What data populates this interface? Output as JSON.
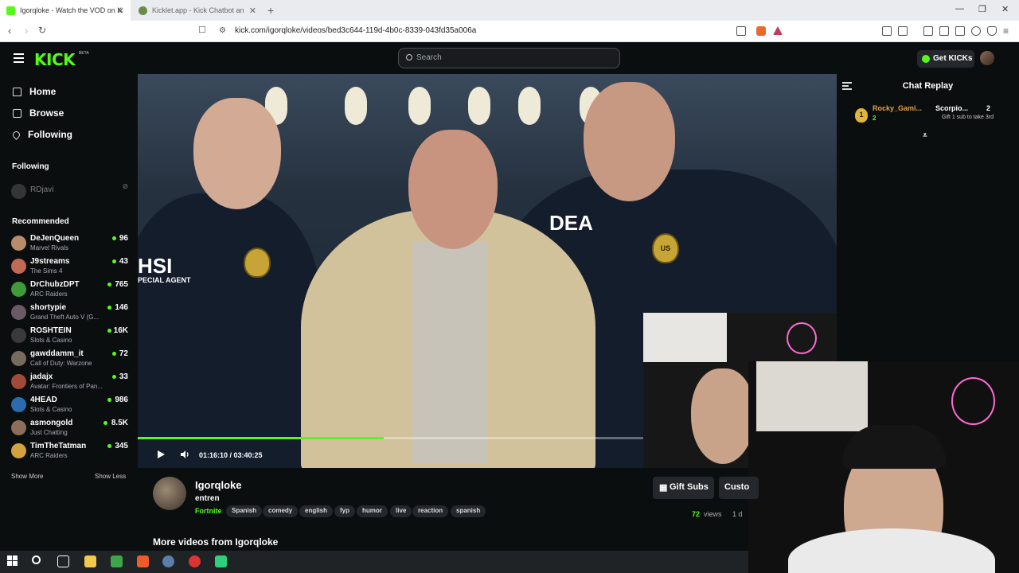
{
  "browser": {
    "tabs": [
      {
        "title": "Igorqloke - Watch the VOD on K",
        "active": true
      },
      {
        "title": "Kicklet.app - Kick Chatbot and C",
        "active": false
      }
    ],
    "url": "kick.com/igorqloke/videos/bed3c644-119d-4b0c-8339-043fd35a006a"
  },
  "header": {
    "logo": "KICK",
    "beta": "BETA",
    "search_placeholder": "Search",
    "get_kicks": "Get KICKs"
  },
  "sidebar": {
    "nav": [
      {
        "label": "Home",
        "icon": "home-icon"
      },
      {
        "label": "Browse",
        "icon": "browse-icon"
      },
      {
        "label": "Following",
        "icon": "heart-icon"
      }
    ],
    "following_heading": "Following",
    "following": [
      {
        "name": "RDjavi"
      }
    ],
    "recommended_heading": "Recommended",
    "recommended": [
      {
        "name": "DeJenQueen",
        "game": "Marvel Rivals",
        "viewers": "96"
      },
      {
        "name": "J9streams",
        "game": "The Sims 4",
        "viewers": "43"
      },
      {
        "name": "DrChubzDPT",
        "game": "ARC Raiders",
        "viewers": "765"
      },
      {
        "name": "shortypie",
        "game": "Grand Theft Auto V (G...",
        "viewers": "146"
      },
      {
        "name": "ROSHTEIN",
        "game": "Slots & Casino",
        "viewers": "16K"
      },
      {
        "name": "gawddamm_it",
        "game": "Call of Duty: Warzone",
        "viewers": "72"
      },
      {
        "name": "jadajx",
        "game": "Avatar: Frontiers of Pan...",
        "viewers": "33"
      },
      {
        "name": "4HEAD",
        "game": "Slots & Casino",
        "viewers": "986"
      },
      {
        "name": "asmongold",
        "game": "Just Chatting",
        "viewers": "8.5K"
      },
      {
        "name": "TimTheTatman",
        "game": "ARC Raiders",
        "viewers": "345"
      }
    ],
    "show_more": "Show More",
    "show_less": "Show Less"
  },
  "player": {
    "time": "01:16:10 / 03:40:25",
    "progress": 0.352,
    "labels": {
      "hsi": "HSI",
      "special_agent": "PECIAL AGENT",
      "dea": "DEA",
      "us": "US"
    }
  },
  "chat": {
    "title": "Chat Replay",
    "gifters": [
      {
        "rank": "1",
        "name": "Rocky_Gami...",
        "count": "2"
      },
      {
        "name": "Scorpio...",
        "count": "2",
        "note": "Gift 1 sub to take 3rd"
      }
    ]
  },
  "channel": {
    "name": "Igorqloke",
    "title": "entren",
    "category": "Fortnite",
    "tags": [
      "Spanish",
      "comedy",
      "english",
      "fyp",
      "humor",
      "live",
      "reaction",
      "spanish"
    ],
    "views_count": "72",
    "views_label": "views",
    "date": "1 d",
    "gift_subs": "Gift Subs",
    "custom": "Custo",
    "more_videos": "More videos from Igorqloke"
  },
  "colors": {
    "accent": "#53fc18",
    "bg": "#0b0e0f",
    "surface": "#24272c"
  }
}
